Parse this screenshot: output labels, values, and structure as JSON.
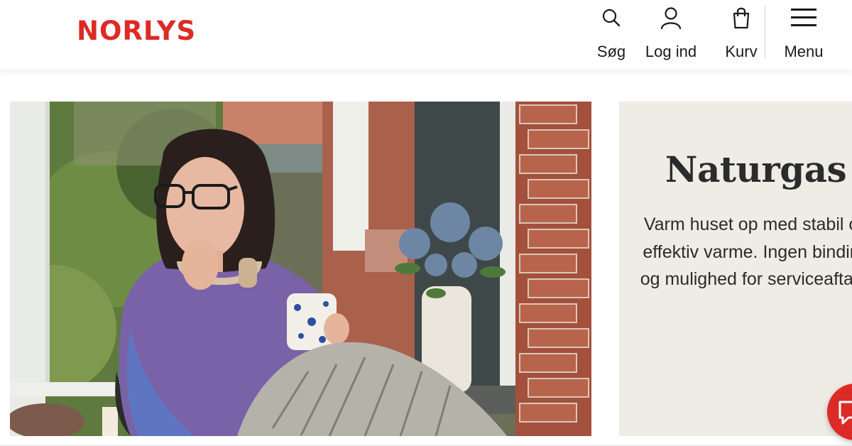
{
  "brand": {
    "logo_text": "NORLYS",
    "accent_color": "#dc2b26"
  },
  "nav": {
    "search_label": "Søg",
    "login_label": "Log ind",
    "cart_label": "Kurv",
    "menu_label": "Menu"
  },
  "hero": {
    "image_subject": "woman-with-coffee-cup-by-window"
  },
  "card": {
    "title": "Naturgas",
    "body": "Varm huset op med stabil og effektiv varme. Ingen binding og mulighed for serviceaftale.",
    "background_color": "#efece6"
  },
  "chat": {
    "icon": "chat-icon"
  }
}
